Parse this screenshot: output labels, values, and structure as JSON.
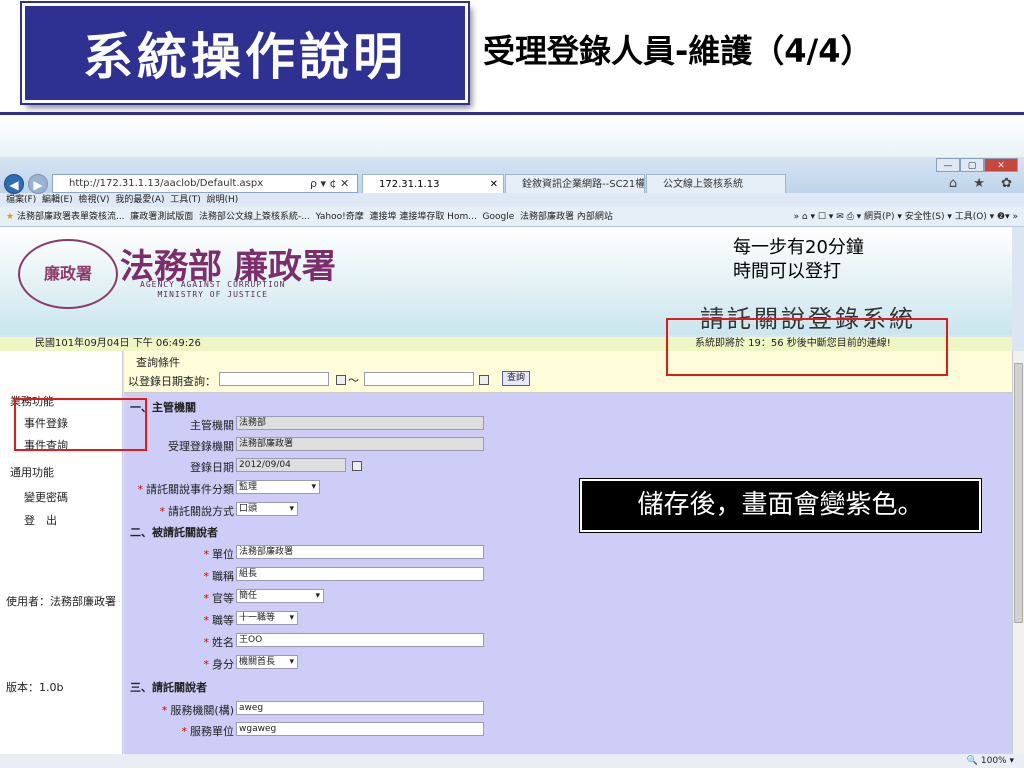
{
  "slide": {
    "title": "系統操作說明",
    "subtitle": "受理登錄人員-維護（4/4）"
  },
  "browser": {
    "address": "http://172.31.1.13/aaclob/Default.aspx",
    "address_tools": "ρ ▾ ¢ ✕",
    "tabs": [
      {
        "label": "172.31.1.13",
        "close": "✕"
      },
      {
        "label": "銓敘資訊企業網路--SC21權限..."
      },
      {
        "label": "公文線上簽核系統"
      }
    ],
    "window_controls": [
      "—",
      "▢",
      "✕"
    ],
    "right_icons": "⌂ ★ ✿",
    "menu_items": [
      "檔案(F)",
      "編輯(E)",
      "檢視(V)",
      "我的最愛(A)",
      "工具(T)",
      "說明(H)"
    ],
    "favorites": [
      "法務部廉政署表單簽核流...",
      "廉政署測試版面",
      "法務部公文線上簽核系統-...",
      "Yahoo!奇摩",
      "連接埠 連接埠存取 Hom...",
      "Google",
      "法務部廉政署 內部網站"
    ],
    "right_tools": "» ⌂ ▾ ☐ ▾ ✉ ⎙ ▾ 網頁(P) ▾ 安全性(S) ▾ 工具(O) ▾ ❷▾ »",
    "zoom": "🔍 100%  ▾"
  },
  "banner": {
    "seal_text": "廉政署",
    "agency_name": "法務部 廉政署",
    "agency_en_1": "AGENCY AGAINST CORRUPTION",
    "agency_en_2": "MINISTRY OF JUSTICE",
    "system_title": "請託關說登錄系統"
  },
  "status": {
    "datetime": "民國101年09月04日 下午 06:49:26",
    "timeout_warning": "系統即將於 19：56 秒後中斷您目前的連線!"
  },
  "sidebar": {
    "group_business": "業務功能",
    "item_event_register": "事件登錄",
    "item_event_query": "事件查詢",
    "group_general": "通用功能",
    "item_change_password": "變更密碼",
    "item_logout": "登　出",
    "user": "使用者：法務部廉政署",
    "version": "版本：1.0b"
  },
  "query": {
    "header": "查詢條件",
    "label": "以登錄日期查詢：",
    "tilde": "～",
    "button": "查詢"
  },
  "form": {
    "section1": "一、主管機關",
    "authority_label": "主管機關",
    "authority_value": "法務部",
    "receiving_label": "受理登錄機關",
    "receiving_value": "法務部廉政署",
    "date_label": "登錄日期",
    "date_value": "2012/09/04",
    "category_label": "請託關說事件分類",
    "category_value": "監理",
    "method_label": "請託關說方式",
    "method_value": "口頭",
    "section2": "二、被請託關說者",
    "unit_label": "單位",
    "unit_value": "法務部廉政署",
    "title_label": "職稱",
    "title_value": "組長",
    "rank_label": "官等",
    "rank_value": "簡任",
    "grade_label": "職等",
    "grade_value": "十一職等",
    "name_label": "姓名",
    "name_value": "王OO",
    "identity_label": "身分",
    "identity_value": "機關首長",
    "section3": "三、請託關說者",
    "service_org_label": "服務機關(構)",
    "service_org_value": "aweg",
    "service_unit_label": "服務單位",
    "service_unit_value": "wgaweg",
    "required_mark": "*"
  },
  "annotations": {
    "note_line1": "每一步有20分鐘",
    "note_line2": "時間可以登打",
    "callout": "儲存後，畫面會變紫色。"
  },
  "colors": {
    "title_bg": "#2e3192",
    "form_bg": "#cdcdf7",
    "highlight_red": "#e01b1b",
    "status_bg": "#eef7c4"
  }
}
